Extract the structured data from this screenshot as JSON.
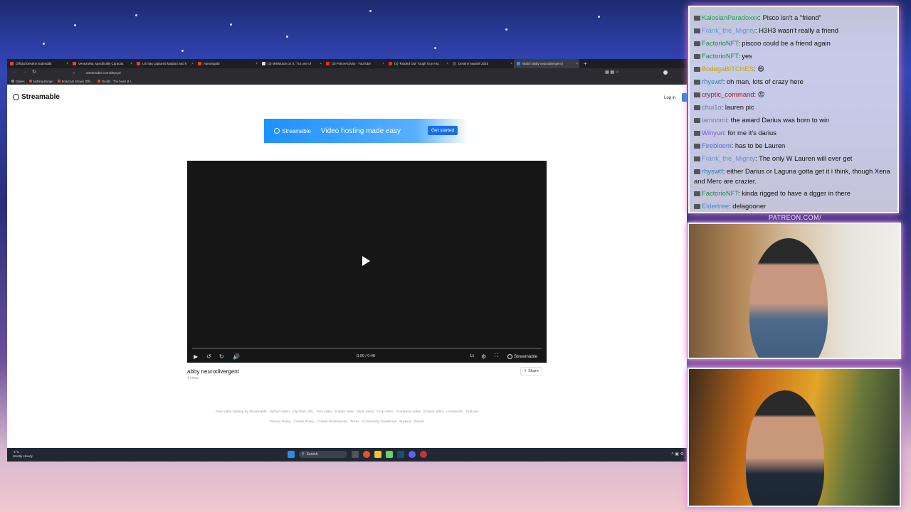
{
  "browser": {
    "tabs": [
      {
        "label": "Official Destiny Subreddit",
        "fav": "#e0433b"
      },
      {
        "label": "Venezuela, specifically Caracas,",
        "fav": "#e0433b"
      },
      {
        "label": "US has captured Maduro and h",
        "fav": "#e0433b"
      },
      {
        "label": "Asmongold",
        "fav": "#e0433b"
      },
      {
        "label": "(3) MrMouton on X: \"So one of",
        "fav": "#dddddd"
      },
      {
        "label": "(3) PoliceActivity - YouTube",
        "fav": "#e52d27"
      },
      {
        "label": "(3) 'Roided Out' Tough Guy Fac",
        "fav": "#e52d27"
      },
      {
        "label": "Destiny Awards 2025",
        "fav": "#4a4a4a"
      },
      {
        "label": "Watch abby neurodivergent |",
        "fav": "#3b82f6"
      }
    ],
    "url": "streamable.com/d6ycyd",
    "bookmarks": [
      "Dailies",
      "Nothing Burger",
      "Bodycam Shows Offic...",
      "Reddit - The heart of t..."
    ]
  },
  "page": {
    "logo_text": "Streamable",
    "login_label": "Log in",
    "ad": {
      "brand": "Streamable",
      "text": "Video hosting made easy",
      "button": "Get started"
    },
    "player": {
      "time": "0:00 / 0:48",
      "speed": "1x",
      "brand": "Streamable",
      "progress": 0
    },
    "video_title": "abby neurodivergent",
    "views": "1 views",
    "share_label": "Share",
    "footer_links_1": [
      "Free video hosting by Streamable",
      "Upload video",
      "Clip from URL",
      "Trim video",
      "Rotate video",
      "Mute video",
      "Crop video",
      "Compress video",
      "Embed video",
      "Livestream",
      "Podcast"
    ],
    "footer_links_2": [
      "Privacy Policy",
      "Cookie Policy",
      "Cookie Preferences",
      "Terms",
      "Community Guidelines",
      "Support",
      "Report"
    ]
  },
  "taskbar": {
    "weather_temp": "-1°C",
    "weather_desc": "Mostly cloudy",
    "search_label": "Search"
  },
  "chat": [
    {
      "user": "KalosianParadoxxx",
      "color": "#1f9e5a",
      "text": " Pisco isn't a \"friend\""
    },
    {
      "user": "Frank_the_Mighty",
      "color": "#6a8fd6",
      "text": " H3H3 wasn't really a friend"
    },
    {
      "user": "FactorioNFT",
      "color": "#1e8a3c",
      "text": " piscoo could be a friend again"
    },
    {
      "user": "FactorioNFT",
      "color": "#1e8a3c",
      "text": " yes"
    },
    {
      "user": "BodegaBITCHES",
      "color": "#c8a000",
      "text": " 😆"
    },
    {
      "user": "rhyswtf",
      "color": "#2a7fb0",
      "text": " oh man, lots of crazy here"
    },
    {
      "user": "cryptic_command",
      "color": "#a01830",
      "text": " 😡"
    },
    {
      "user": "chui1o",
      "color": "#6a7a9a",
      "text": " lauren pic"
    },
    {
      "user": "lamnomi",
      "color": "#7a7aa0",
      "text": " the award Darius was born to win"
    },
    {
      "user": "Winyun",
      "color": "#7a55c8",
      "text": " for me it's darius"
    },
    {
      "user": "Firebloom",
      "color": "#5a6ad0",
      "text": " has to be Lauren"
    },
    {
      "user": "Frank_the_Mighty",
      "color": "#6a8fd6",
      "text": " The only W Lauren will ever get"
    },
    {
      "user": "rhyswtf",
      "color": "#2a7fb0",
      "text": " either Darius or Laguna gotta get it i think, though Xena and Merc are crazier."
    },
    {
      "user": "FactorioNFT",
      "color": "#1e8a3c",
      "text": " kinda rigged to have a dgger in there"
    },
    {
      "user": "Eldertree",
      "color": "#3a8ad8",
      "text": " delagooner"
    }
  ],
  "overlay": {
    "patreon": "PATREON.COM/"
  },
  "colors": {
    "accent": "#1e88e5",
    "glow": "#ff6ad5"
  }
}
